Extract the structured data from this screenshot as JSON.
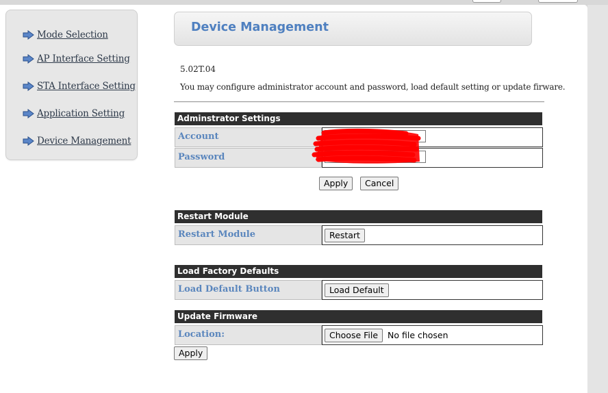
{
  "sidebar": {
    "items": [
      {
        "label": "Mode Selection"
      },
      {
        "label": "AP Interface Setting"
      },
      {
        "label": "STA Interface Setting"
      },
      {
        "label": "Application Setting"
      },
      {
        "label": "Device Management"
      }
    ]
  },
  "header": {
    "title": "Device Management"
  },
  "version": "5.02T.04",
  "description": "You may configure administrator account and password, load default setting or update firware.",
  "admin": {
    "heading": "Adminstrator Settings",
    "account_label": "Account",
    "account_value": "",
    "password_label": "Password",
    "password_value": "",
    "apply_label": "Apply",
    "cancel_label": "Cancel"
  },
  "restart": {
    "heading": "Restart Module",
    "label": "Restart Module",
    "button_label": "Restart"
  },
  "factory": {
    "heading": "Load Factory Defaults",
    "label": "Load Default Button",
    "button_label": "Load Default"
  },
  "firmware": {
    "heading": "Update Firmware",
    "location_label": "Location:",
    "choose_file_label": "Choose File",
    "no_file_text": "No file chosen",
    "apply_label": "Apply"
  },
  "colors": {
    "accent": "#4f80c0",
    "section_header": "#2f2f2f",
    "label_text": "#5a86bd",
    "redaction": "#ff0000"
  }
}
